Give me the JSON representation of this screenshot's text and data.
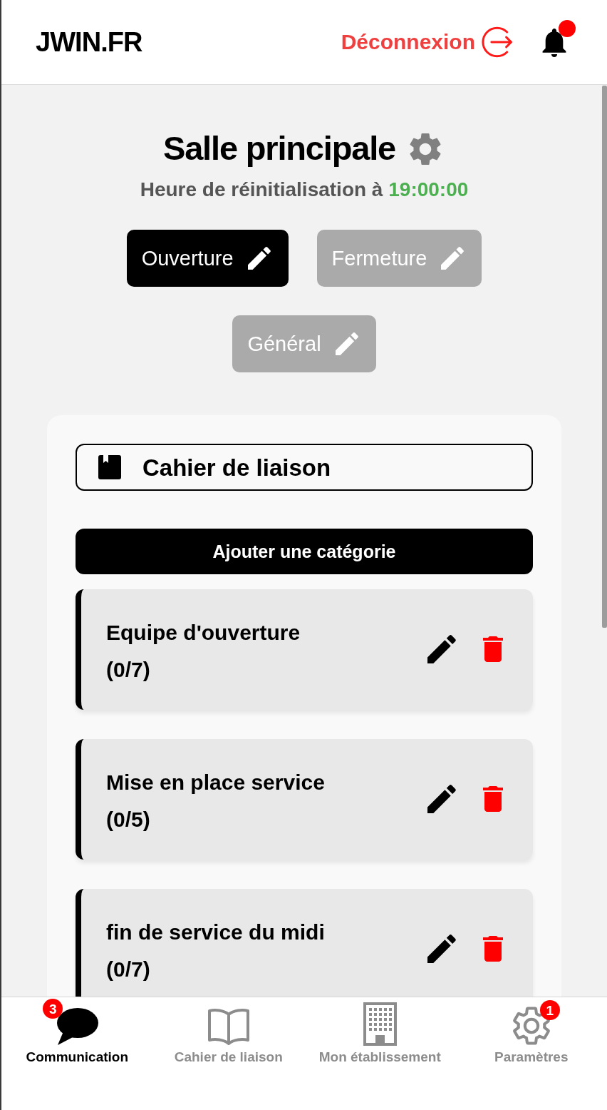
{
  "header": {
    "logo": "JWIN.FR",
    "logout": "Déconnexion",
    "has_notifications": true
  },
  "room": {
    "title": "Salle principale",
    "reset_label": "Heure de réinitialisation à",
    "reset_time": "19:00:00"
  },
  "tabs": [
    {
      "label": "Ouverture",
      "selected": true
    },
    {
      "label": "Fermeture",
      "selected": false
    },
    {
      "label": "Général",
      "selected": false
    }
  ],
  "checklist": {
    "title": "Cahier de liaison",
    "add_button": "Ajouter une catégorie",
    "categories": [
      {
        "name": "Equipe d'ouverture",
        "count": "(0/7)"
      },
      {
        "name": "Mise en place service",
        "count": "(0/5)"
      },
      {
        "name": "fin de service du midi",
        "count": "(0/7)"
      }
    ]
  },
  "bottom_nav": [
    {
      "label": "Communication",
      "selected": true,
      "badge": "3"
    },
    {
      "label": "Cahier de liaison",
      "selected": false
    },
    {
      "label": "Mon établissement",
      "selected": false
    },
    {
      "label": "Paramètres",
      "selected": false,
      "badge": "1"
    }
  ]
}
